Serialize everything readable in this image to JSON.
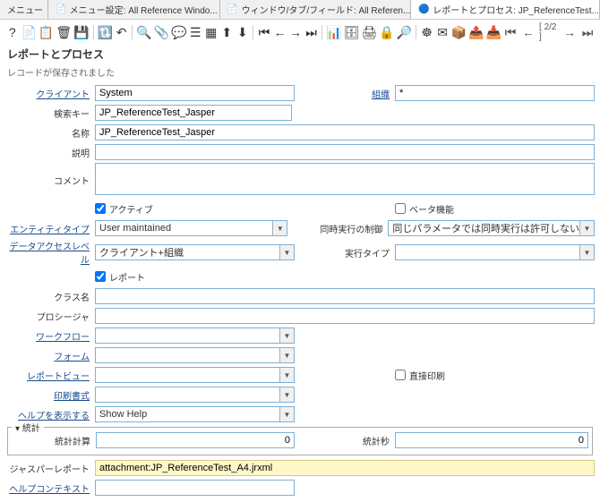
{
  "tabs": [
    {
      "label": "メニュー",
      "icon": ""
    },
    {
      "label": "メニュー設定: All Reference Windo...",
      "icon": "📄"
    },
    {
      "label": "ウィンドウ/タブ/フィールド: All Referen...",
      "icon": "📄"
    },
    {
      "label": "レポートとプロセス: JP_ReferenceTest...",
      "icon": "🔵",
      "active": true
    }
  ],
  "toolbar": [
    {
      "name": "help",
      "glyph": "?"
    },
    {
      "name": "new",
      "glyph": "📄"
    },
    {
      "name": "copy",
      "glyph": "📋"
    },
    {
      "name": "delete",
      "glyph": "🗑"
    },
    {
      "name": "save",
      "glyph": "💾"
    },
    {
      "sep": true
    },
    {
      "name": "refresh",
      "glyph": "🔃"
    },
    {
      "name": "undo",
      "glyph": "↶"
    },
    {
      "sep": true
    },
    {
      "name": "find",
      "glyph": "🔍"
    },
    {
      "name": "attach",
      "glyph": "📎"
    },
    {
      "name": "chat",
      "glyph": "💬"
    },
    {
      "name": "toggle",
      "glyph": "☰"
    },
    {
      "name": "grid",
      "glyph": "▦"
    },
    {
      "name": "parent",
      "glyph": "⬆"
    },
    {
      "name": "detail",
      "glyph": "⬇"
    },
    {
      "sep": true
    },
    {
      "name": "first",
      "glyph": "⏮"
    },
    {
      "name": "prev",
      "glyph": "←"
    },
    {
      "name": "next",
      "glyph": "→"
    },
    {
      "name": "last",
      "glyph": "⏭"
    },
    {
      "sep": true
    },
    {
      "name": "report",
      "glyph": "📊"
    },
    {
      "name": "archive",
      "glyph": "🗄"
    },
    {
      "name": "print",
      "glyph": "🖨"
    },
    {
      "name": "lock",
      "glyph": "🔒"
    },
    {
      "name": "zoom",
      "glyph": "🔎"
    },
    {
      "sep": true
    },
    {
      "name": "workflow",
      "glyph": "☸"
    },
    {
      "name": "request",
      "glyph": "✉"
    },
    {
      "name": "product",
      "glyph": "📦"
    },
    {
      "name": "export",
      "glyph": "📤"
    },
    {
      "name": "import",
      "glyph": "📥"
    }
  ],
  "nav": {
    "first": "⏮",
    "prev": "←",
    "counter": "[ 2/2 ]",
    "next": "→",
    "last": "⏭"
  },
  "title": "レポートとプロセス",
  "status": "レコードが保存されました",
  "labels": {
    "client": "クライアント",
    "org": "組織",
    "searchkey": "検索キー",
    "name": "名称",
    "desc": "説明",
    "comment": "コメント",
    "active": "アクティブ",
    "beta": "ベータ機能",
    "entitytype": "エンティティタイプ",
    "concurrent": "同時実行の制御",
    "dataaccess": "データアクセスレベル",
    "exectype": "実行タイプ",
    "report": "レポート",
    "classname": "クラス名",
    "procedure": "プロシージャ",
    "workflow": "ワークフロー",
    "form": "フォーム",
    "reportview": "レポートビュー",
    "directprint": "直接印刷",
    "printformat": "印刷書式",
    "showhelp": "ヘルプを表示する",
    "section_stats": "統計",
    "statcalc": "統計計算",
    "statsec": "統計秒",
    "jasper": "ジャスパーレポート",
    "helpctx": "ヘルプコンテキスト"
  },
  "values": {
    "client": "System",
    "org": "*",
    "searchkey": "JP_ReferenceTest_Jasper",
    "name": "JP_ReferenceTest_Jasper",
    "desc": "",
    "comment": "",
    "active": true,
    "beta": false,
    "entitytype": "User maintained",
    "concurrent": "同じパラメータでは同時実行は許可しない",
    "dataaccess": "クライアント+組織",
    "exectype": "",
    "report": true,
    "classname": "",
    "procedure": "",
    "workflow": "",
    "form": "",
    "reportview": "",
    "directprint": false,
    "printformat": "",
    "showhelp": "Show Help",
    "statcalc": "0",
    "statsec": "0",
    "jasper": "attachment:JP_ReferenceTest_A4.jrxml",
    "helpctx": ""
  }
}
